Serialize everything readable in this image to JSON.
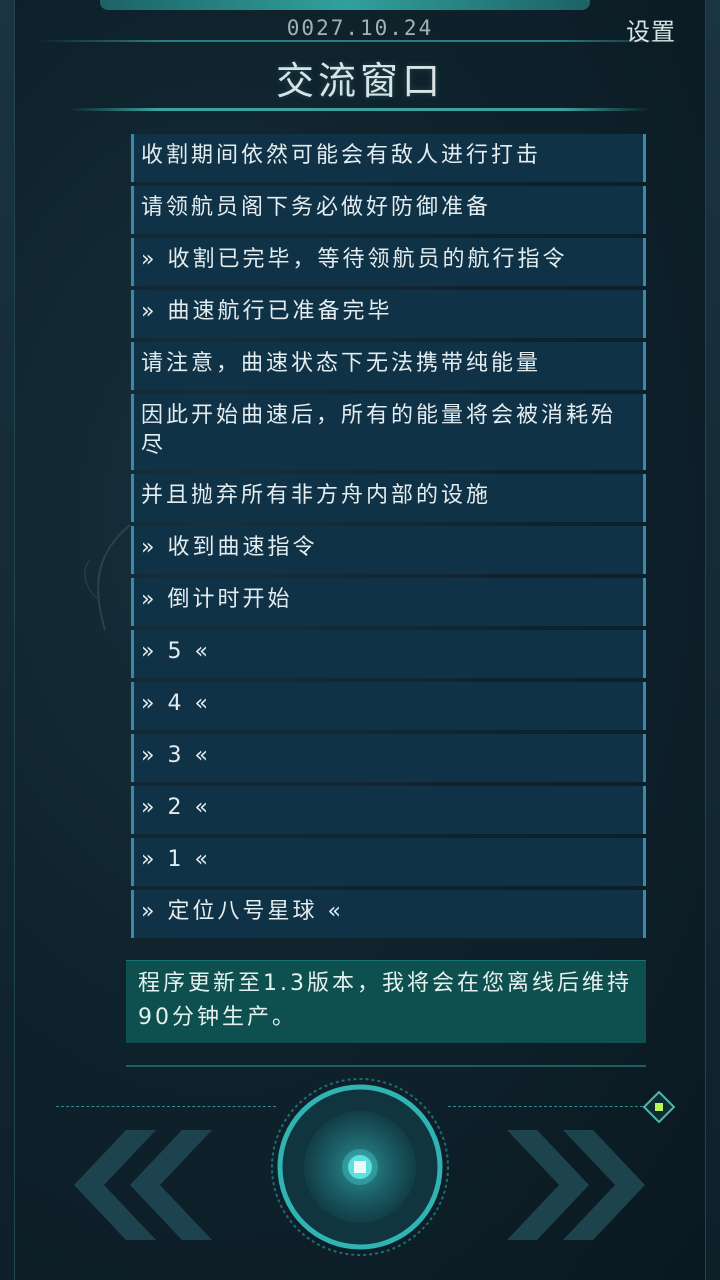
{
  "header": {
    "date": "0027.10.24",
    "settings_label": "设置",
    "title": "交流窗口"
  },
  "messages": [
    "收割期间依然可能会有敌人进行打击",
    "请领航员阁下务必做好防御准备",
    "» 收割已完毕，等待领航员的航行指令",
    "» 曲速航行已准备完毕",
    "请注意，曲速状态下无法携带纯能量",
    "因此开始曲速后，所有的能量将会被消耗殆尽",
    "并且抛弃所有非方舟内部的设施",
    "» 收到曲速指令",
    "» 倒计时开始",
    "» 5 «",
    "» 4 «",
    "» 3 «",
    "» 2 «",
    "» 1 «",
    "» 定位八号星球 «"
  ],
  "system_message": "程序更新至1.3版本，我将会在您离线后维持90分钟生产。",
  "controls": {
    "left_icon": "double-chevron-left-icon",
    "center_icon": "center-target-button-icon",
    "right_icon": "double-chevron-right-icon",
    "corner_icon": "diamond-indicator-icon"
  },
  "colors": {
    "background": "#0c1a22",
    "message_bg": "#103246",
    "message_border": "#3c89a8",
    "system_bg": "#0e5050",
    "accent": "#2fb3b3"
  }
}
